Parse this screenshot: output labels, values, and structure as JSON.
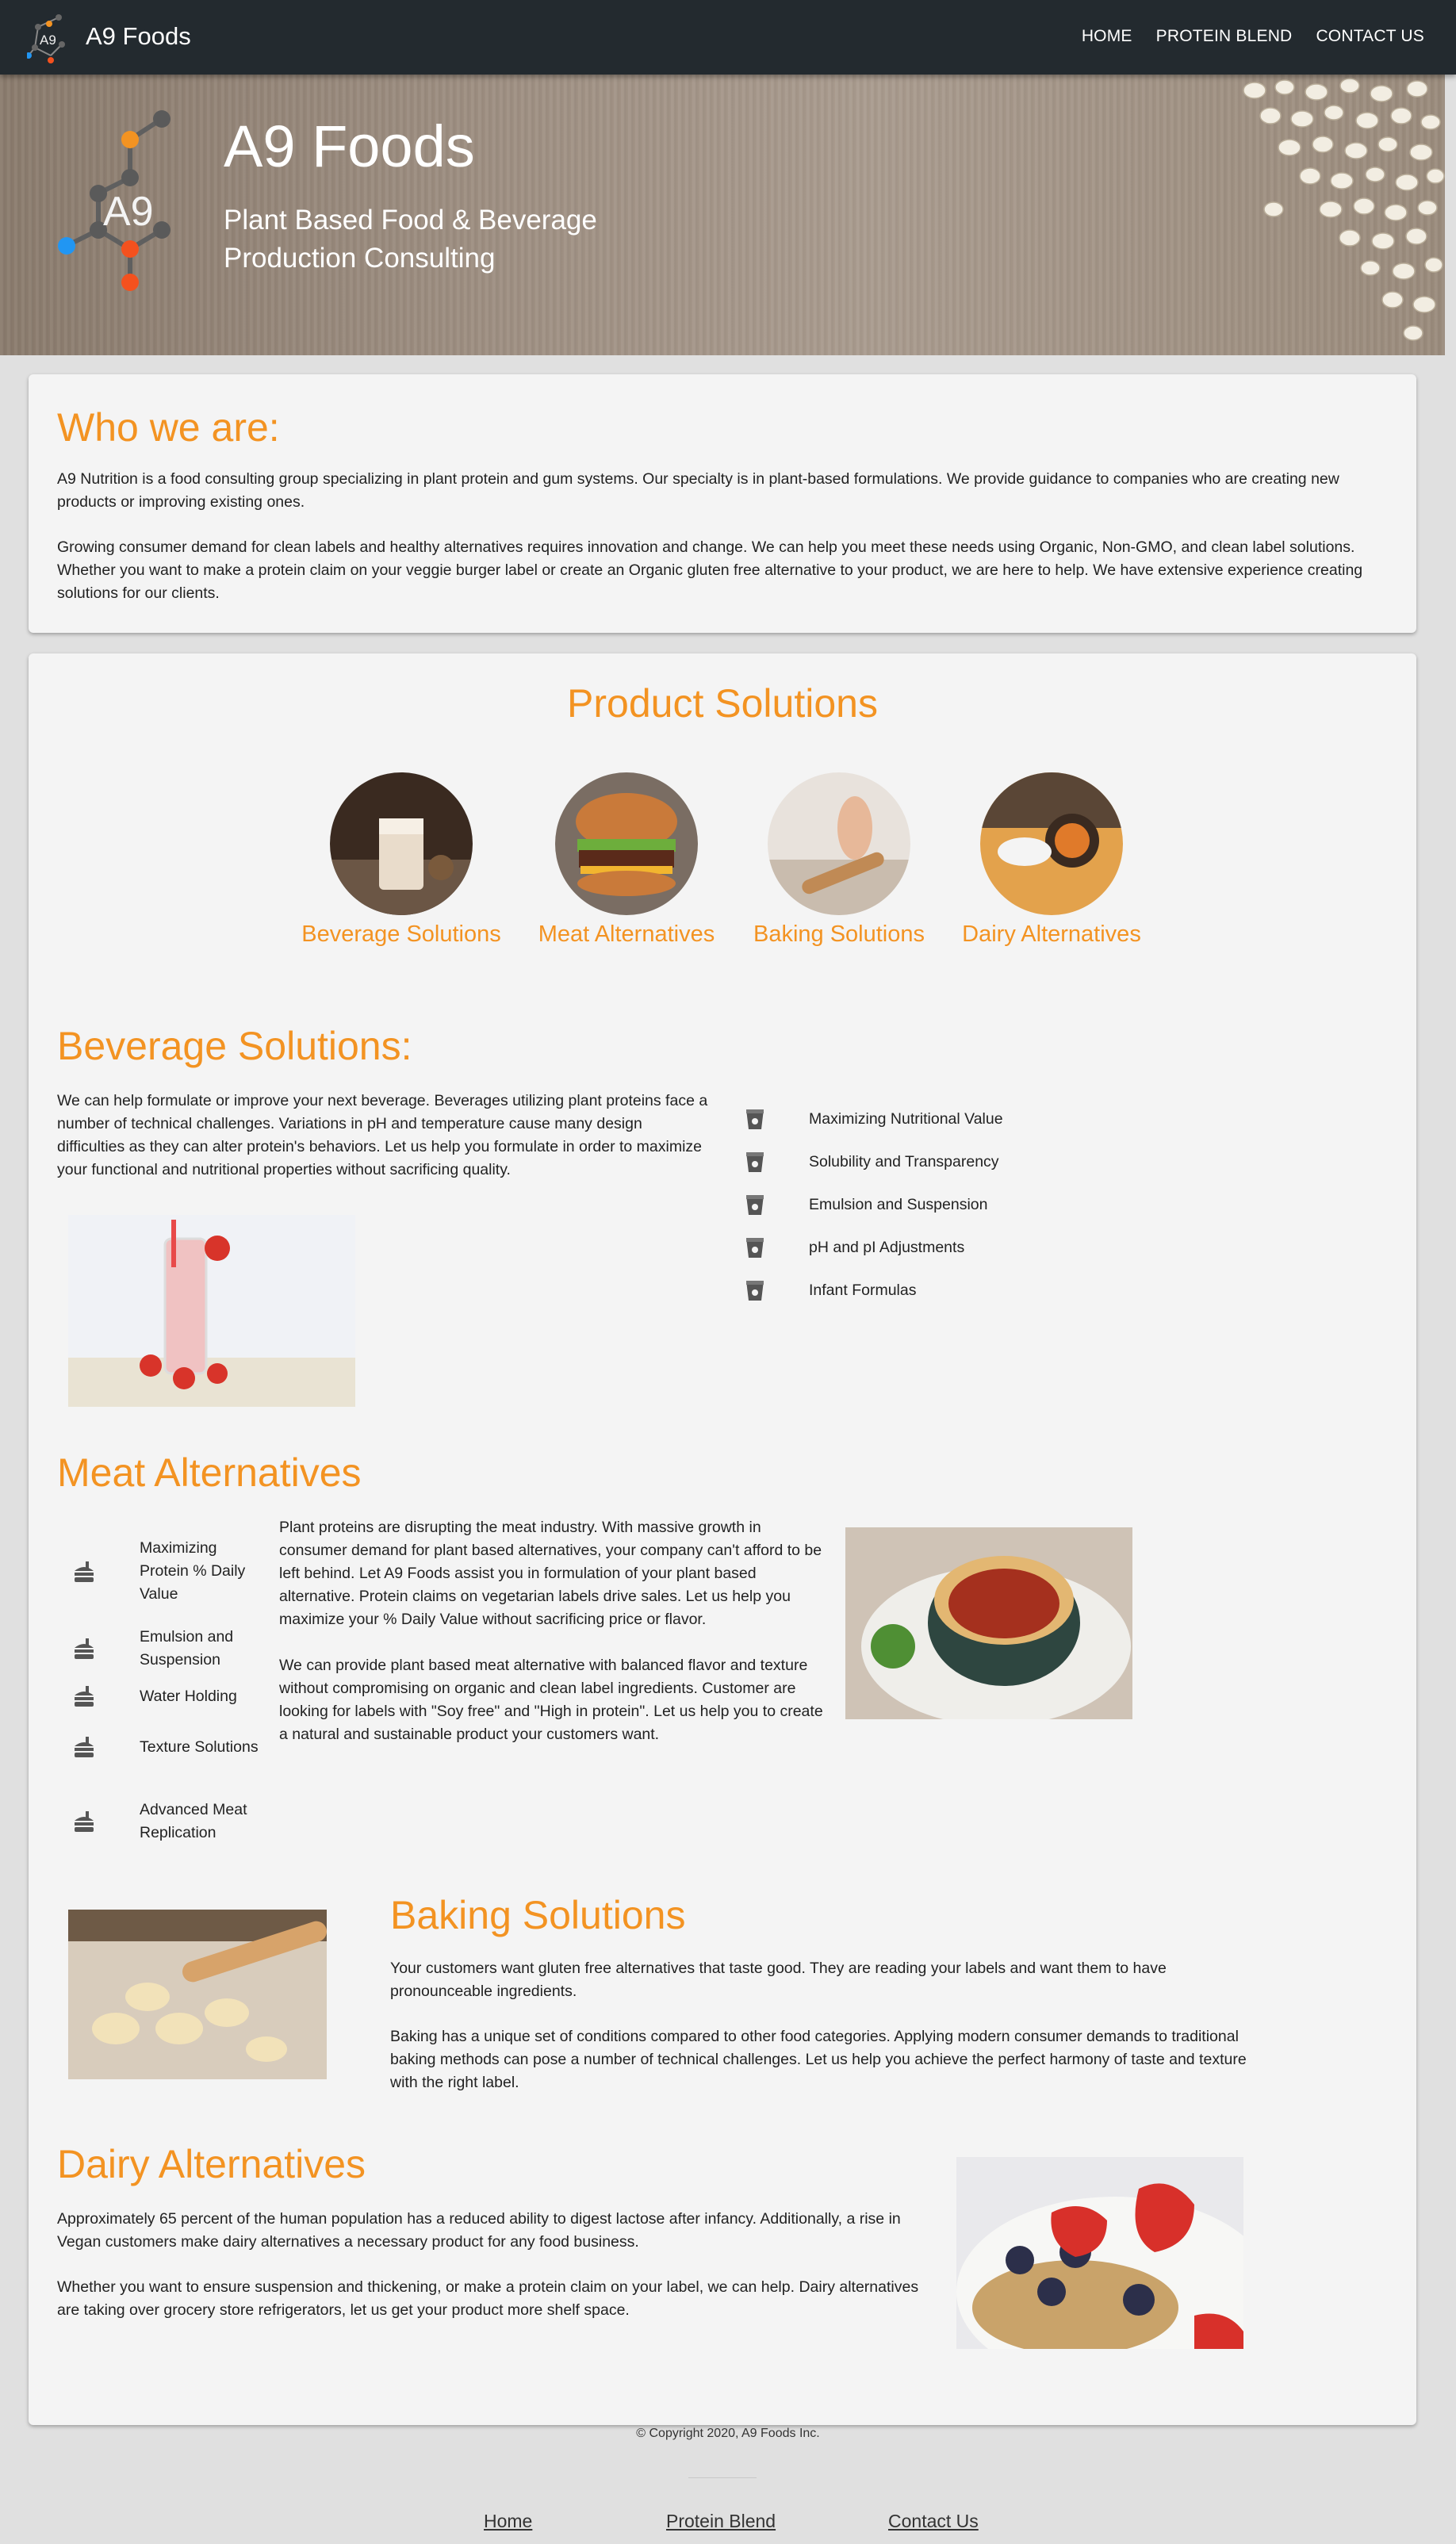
{
  "nav": {
    "brand": "A9 Foods",
    "logo_text": "A9",
    "links": [
      "HOME",
      "PROTEIN BLEND",
      "CONTACT US"
    ]
  },
  "hero": {
    "title": "A9 Foods",
    "subtitle": "Plant Based Food & Beverage Production Consulting",
    "logo_text": "A9"
  },
  "who": {
    "title": "Who we are:",
    "p1": "A9 Nutrition is a food consulting group specializing in plant protein and gum systems. Our specialty is in plant-based formulations. We provide guidance to companies who are creating new products or improving existing ones.",
    "p2": "Growing consumer demand for clean labels and healthy alternatives requires innovation and change. We can help you meet these needs using Organic, Non-GMO, and clean label solutions. Whether you want to make a protein claim on your veggie burger label or create an Organic gluten free alternative to your product, we are here to help. We have extensive experience creating solutions for our clients."
  },
  "products": {
    "title": "Product Solutions",
    "items": [
      "Beverage Solutions",
      "Meat Alternatives",
      "Baking Solutions",
      "Dairy Alternatives"
    ]
  },
  "beverage": {
    "title": "Beverage Solutions:",
    "text": "We can help formulate or improve your next beverage. Beverages utilizing plant proteins face a number of technical challenges. Variations in pH and temperature cause many design difficulties as they can alter protein's behaviors. Let us help you formulate in order to maximize your functional and nutritional properties without sacrificing quality.",
    "features": [
      "Maximizing Nutritional Value",
      "Solubility and Transparency",
      "Emulsion and Suspension",
      "pH and pI Adjustments",
      "Infant Formulas"
    ]
  },
  "meat": {
    "title": "Meat Alternatives",
    "features": [
      "Maximizing Protein % Daily Value",
      "Emulsion and Suspension",
      "Water Holding",
      "Texture Solutions",
      "Advanced Meat Replication"
    ],
    "p1": "Plant proteins are disrupting the meat industry. With massive growth in consumer demand for plant based alternatives, your company can't afford to be left behind. Let A9 Foods assist you in formulation of your plant based alternative. Protein claims on vegetarian labels drive sales. Let us help you maximize your % Daily Value without sacrificing price or flavor.",
    "p2": "We can provide plant based meat alternative with balanced flavor and texture without compromising on organic and clean label ingredients. Customer are looking for labels with \"Soy free\" and \"High in protein\". Let us help you to create a natural and sustainable product your customers want."
  },
  "baking": {
    "title": "Baking Solutions",
    "p1": "Your customers want gluten free alternatives that taste good. They are reading your labels and want them to have pronounceable ingredients.",
    "p2": "Baking has a unique set of conditions compared to other food categories. Applying modern consumer demands to traditional baking methods can pose a number of technical challenges. Let us help you achieve the perfect harmony of taste and texture with the right label."
  },
  "dairy": {
    "title": "Dairy Alternatives",
    "p1": "Approximately 65 percent of the human population has a reduced ability to digest lactose after infancy. Additionally, a rise in Vegan customers make dairy alternatives a necessary product for any food business.",
    "p2": "Whether you want to ensure suspension and thickening, or make a protein claim on your label, we can help. Dairy alternatives are taking over grocery store refrigerators, let us get your product more shelf space."
  },
  "footer": {
    "copyright": "© Copyright 2020, A9 Foods Inc.",
    "links": [
      "Home",
      "Protein Blend",
      "Contact Us"
    ]
  },
  "colors": {
    "accent": "#f39322",
    "nav_bg": "#232a2f",
    "card_bg": "#f4f4f4",
    "page_bg": "#e0e0e0"
  }
}
